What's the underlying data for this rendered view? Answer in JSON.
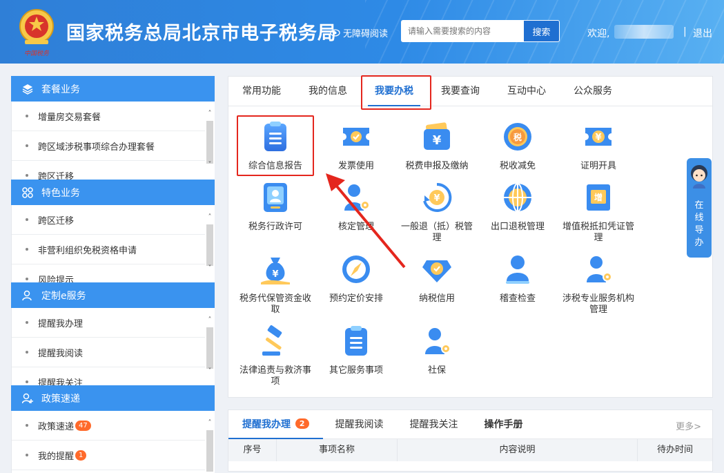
{
  "header": {
    "site_title": "国家税务总局北京市电子税务局",
    "accessibility_label": "无障碍阅读",
    "search_placeholder": "请输入需要搜索的内容",
    "search_button": "搜索",
    "welcome": "欢迎,",
    "separator": "|",
    "logout": "退出",
    "emblem_caption": "中国税务"
  },
  "sidebar": {
    "sections": [
      {
        "title": "套餐业务",
        "icon": "layers-icon",
        "items": [
          {
            "label": "增量房交易套餐"
          },
          {
            "label": "跨区域涉税事项综合办理套餐"
          },
          {
            "label": "跨区迁移"
          }
        ]
      },
      {
        "title": "特色业务",
        "icon": "grid-icon",
        "items": [
          {
            "label": "跨区迁移"
          },
          {
            "label": "非营利组织免税资格申请"
          },
          {
            "label": "风险提示"
          }
        ]
      },
      {
        "title": "定制e服务",
        "icon": "user-icon",
        "items": [
          {
            "label": "提醒我办理"
          },
          {
            "label": "提醒我阅读"
          },
          {
            "label": "提醒我关注"
          }
        ]
      },
      {
        "title": "政策速递",
        "icon": "user-plus-icon",
        "items": [
          {
            "label": "政策速递",
            "badge": "47"
          },
          {
            "label": "我的提醒",
            "badge": "1"
          }
        ]
      }
    ]
  },
  "main": {
    "tabs": [
      "常用功能",
      "我的信息",
      "我要办税",
      "我要查询",
      "互动中心",
      "公众服务"
    ],
    "active_tab": "我要办税",
    "items": [
      {
        "label": "综合信息报告",
        "icon": "document-list-icon"
      },
      {
        "label": "发票使用",
        "icon": "invoice-ticket-icon"
      },
      {
        "label": "税费申报及缴纳",
        "icon": "yuan-wallet-icon"
      },
      {
        "label": "税收减免",
        "icon": "tax-reduction-icon"
      },
      {
        "label": "证明开具",
        "icon": "certificate-icon"
      },
      {
        "label": "税务行政许可",
        "icon": "license-card-icon"
      },
      {
        "label": "核定管理",
        "icon": "user-gear-icon"
      },
      {
        "label": "一般退（抵）税管理",
        "icon": "refund-cycle-icon"
      },
      {
        "label": "出口退税管理",
        "icon": "globe-icon"
      },
      {
        "label": "增值税抵扣凭证管理",
        "icon": "vat-receipt-icon"
      },
      {
        "label": "税务代保管资金收取",
        "icon": "money-bag-icon"
      },
      {
        "label": "预约定价安排",
        "icon": "compass-icon"
      },
      {
        "label": "纳税信用",
        "icon": "diamond-check-icon"
      },
      {
        "label": "稽查检查",
        "icon": "person-icon"
      },
      {
        "label": "涉税专业服务机构管理",
        "icon": "agency-gear-icon"
      },
      {
        "label": "法律追责与救济事项",
        "icon": "gavel-icon"
      },
      {
        "label": "其它服务事项",
        "icon": "clipboard-icon"
      },
      {
        "label": "社保",
        "icon": "social-security-icon"
      }
    ]
  },
  "bottom": {
    "tabs": [
      {
        "label": "提醒我办理",
        "badge": "2"
      },
      {
        "label": "提醒我阅读"
      },
      {
        "label": "提醒我关注"
      },
      {
        "label": "操作手册"
      }
    ],
    "more": "更多>",
    "columns": [
      "序号",
      "事项名称",
      "内容说明",
      "待办时间"
    ]
  },
  "float_guide": {
    "label": "在线导办",
    "chars": [
      "在",
      "线",
      "导",
      "办"
    ]
  },
  "colors": {
    "brand_blue": "#2e8ae6",
    "accent_blue": "#1f6fd1",
    "highlight_red": "#e4261d",
    "badge_orange": "#ff6a2b"
  }
}
